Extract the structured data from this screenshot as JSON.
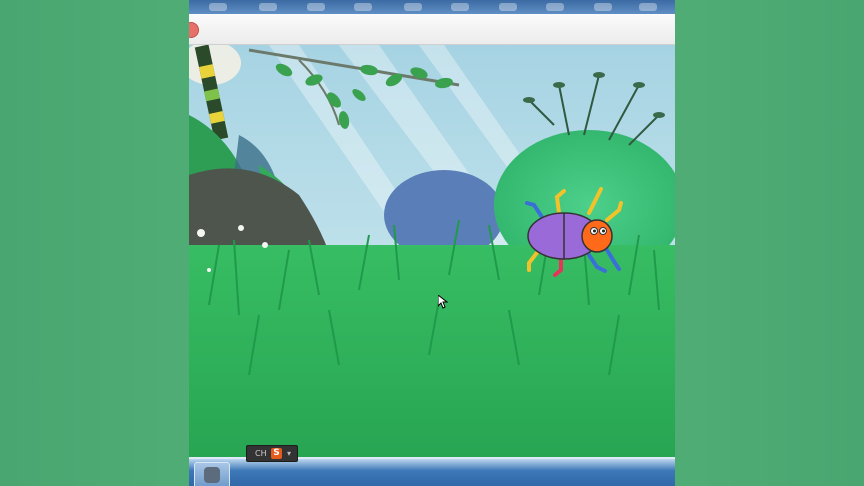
{
  "window": {
    "title": ""
  },
  "stage": {
    "scene": "jungle-grass-backdrop",
    "sprite": "beetle-sprite",
    "colors": {
      "sky": "#bfe0ec",
      "grass": "#2fb35a",
      "grass_dark": "#1f9a4a",
      "beetle_body": "#9a6ad8",
      "beetle_head": "#ff6a1a"
    }
  },
  "ime_bar": {
    "mode_label": "CH",
    "logo_label": "S",
    "arrow": "▾"
  },
  "taskbar": {
    "app_icon": "scratch-app-icon"
  }
}
